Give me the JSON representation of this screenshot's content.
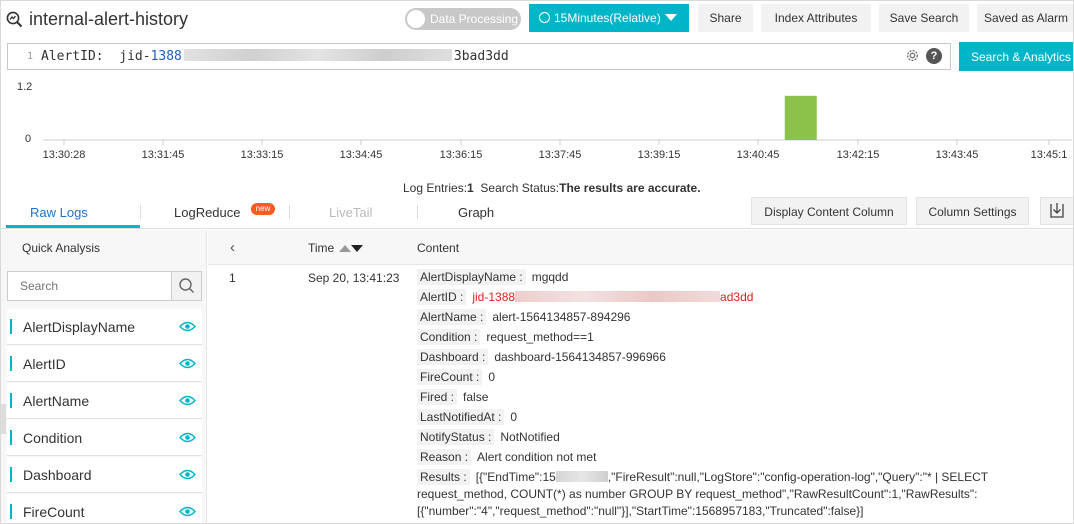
{
  "header": {
    "logstore_name": "internal-alert-history",
    "toggle_label": "Data Processing",
    "time_range": "15Minutes(Relative)",
    "buttons": [
      "Share",
      "Index Attributes",
      "Save Search",
      "Saved as Alarm"
    ]
  },
  "query": {
    "line_number": "1",
    "prefix": "AlertID:  jid-",
    "value_start": "1388",
    "value_end": "3bad3dd",
    "search_button": "Search & Analytics"
  },
  "histogram": {
    "y_max_label": "1.2",
    "y_min_label": "0",
    "ticks": [
      "13:30:28",
      "13:31:45",
      "13:33:15",
      "13:34:45",
      "13:36:15",
      "13:37:45",
      "13:39:15",
      "13:40:45",
      "13:42:15",
      "13:43:45",
      "13:45:1"
    ],
    "bar_color": "#8bc34a",
    "bar_value": 1,
    "bar_at": "13:41:23"
  },
  "status": {
    "entries_label": "Log Entries:",
    "entries_value": "1",
    "search_status_label": "Search Status:",
    "search_status_value": "The results are accurate."
  },
  "tabs": {
    "items": [
      "Raw Logs",
      "LogReduce",
      "LiveTail",
      "Graph"
    ],
    "new_badge": "new",
    "active": "Raw Logs",
    "display_content_column": "Display Content Column",
    "column_settings": "Column Settings"
  },
  "quick_analysis": {
    "title": "Quick Analysis",
    "search_placeholder": "Search",
    "fields": [
      "AlertDisplayName",
      "AlertID",
      "AlertName",
      "Condition",
      "Dashboard",
      "FireCount"
    ]
  },
  "log_table": {
    "col_time": "Time",
    "col_content": "Content",
    "rows": [
      {
        "index": "1",
        "time": "Sep 20, 13:41:23",
        "fields": [
          {
            "key": "AlertDisplayName",
            "value": "mgqdd"
          },
          {
            "key": "AlertID",
            "value_start": "jid-1388",
            "value_end": "ad3dd"
          },
          {
            "key": "AlertName",
            "value": "alert-1564134857-894296"
          },
          {
            "key": "Condition",
            "value": "request_method==1"
          },
          {
            "key": "Dashboard",
            "value": "dashboard-1564134857-996966"
          },
          {
            "key": "FireCount",
            "value": "0"
          },
          {
            "key": "Fired",
            "value": "false"
          },
          {
            "key": "LastNotifiedAt",
            "value": "0"
          },
          {
            "key": "NotifyStatus",
            "value": "NotNotified"
          },
          {
            "key": "Reason",
            "value": "Alert condition not met"
          },
          {
            "key": "Results",
            "value_start": "[{\"EndTime\":15",
            "value_end": ",\"FireResult\":null,\"LogStore\":\"config-operation-log\",\"Query\":\"* | SELECT",
            "line2": "request_method, COUNT(*) as number GROUP BY request_method\",\"RawResultCount\":1,\"RawResults\":",
            "line3": "[{\"number\":\"4\",\"request_method\":\"null\"}],\"StartTime\":1568957183,\"Truncated\":false}]"
          }
        ]
      }
    ]
  },
  "colors": {
    "accent": "#00b5c7",
    "active_tab": "#1a75c8",
    "highlight_red": "#e0211a"
  }
}
